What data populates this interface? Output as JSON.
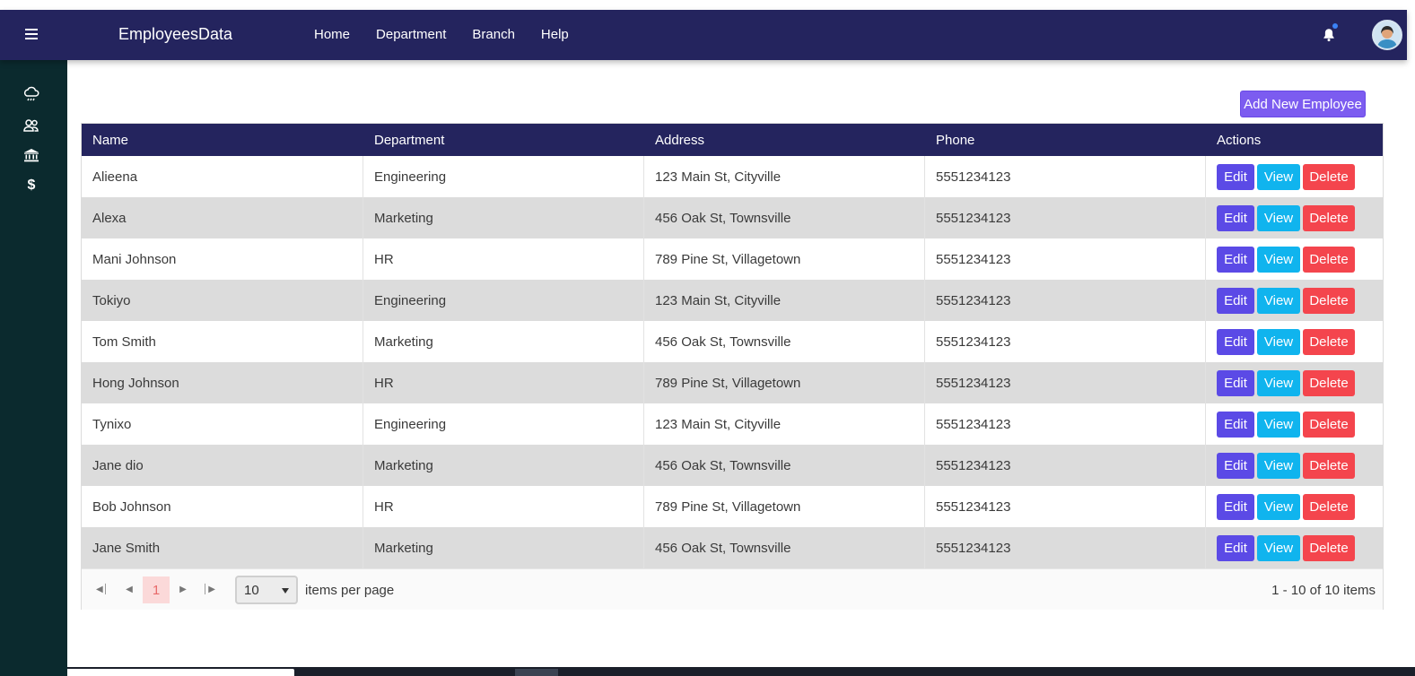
{
  "app": {
    "brand": "EmployeesData"
  },
  "nav": {
    "items": [
      "Home",
      "Department",
      "Branch",
      "Help"
    ]
  },
  "icons": {
    "menu": "hamburger-icon",
    "notifications": "bell-icon",
    "avatar": "user-avatar",
    "sidebar": [
      "weather-icon",
      "users-icon",
      "bank-icon",
      "dollar-icon"
    ]
  },
  "sidebar": {
    "dollar_glyph": "$"
  },
  "toolbar": {
    "add_label": "Add New Employee"
  },
  "table": {
    "columns": [
      "Name",
      "Department",
      "Address",
      "Phone",
      "Actions"
    ],
    "rows": [
      {
        "name": "Alieena",
        "department": "Engineering",
        "address": "123 Main St, Cityville",
        "phone": "5551234123"
      },
      {
        "name": "Alexa",
        "department": "Marketing",
        "address": "456 Oak St, Townsville",
        "phone": "5551234123"
      },
      {
        "name": "Mani Johnson",
        "department": "HR",
        "address": "789 Pine St, Villagetown",
        "phone": "5551234123"
      },
      {
        "name": "Tokiyo",
        "department": "Engineering",
        "address": "123 Main St, Cityville",
        "phone": "5551234123"
      },
      {
        "name": "Tom Smith",
        "department": "Marketing",
        "address": "456 Oak St, Townsville",
        "phone": "5551234123"
      },
      {
        "name": "Hong Johnson",
        "department": "HR",
        "address": "789 Pine St, Villagetown",
        "phone": "5551234123"
      },
      {
        "name": "Tynixo",
        "department": "Engineering",
        "address": "123 Main St, Cityville",
        "phone": "5551234123"
      },
      {
        "name": "Jane dio",
        "department": "Marketing",
        "address": "456 Oak St, Townsville",
        "phone": "5551234123"
      },
      {
        "name": "Bob Johnson",
        "department": "HR",
        "address": "789 Pine St, Villagetown",
        "phone": "5551234123"
      },
      {
        "name": "Jane Smith",
        "department": "Marketing",
        "address": "456 Oak St, Townsville",
        "phone": "5551234123"
      }
    ],
    "actions": {
      "edit": "Edit",
      "view": "View",
      "delete": "Delete"
    }
  },
  "pager": {
    "current_page": "1",
    "page_size": "10",
    "items_per_page_label": "items per page",
    "range_text": "1 - 10 of 10 items"
  },
  "colors": {
    "navbar": "#24245e",
    "sidebar": "#0b2a2e",
    "add_button": "#7c5cf0",
    "edit_button": "#5b4ae6",
    "view_button": "#10b4ee",
    "delete_button": "#f4454d",
    "row_alt": "#dcdcdc"
  }
}
